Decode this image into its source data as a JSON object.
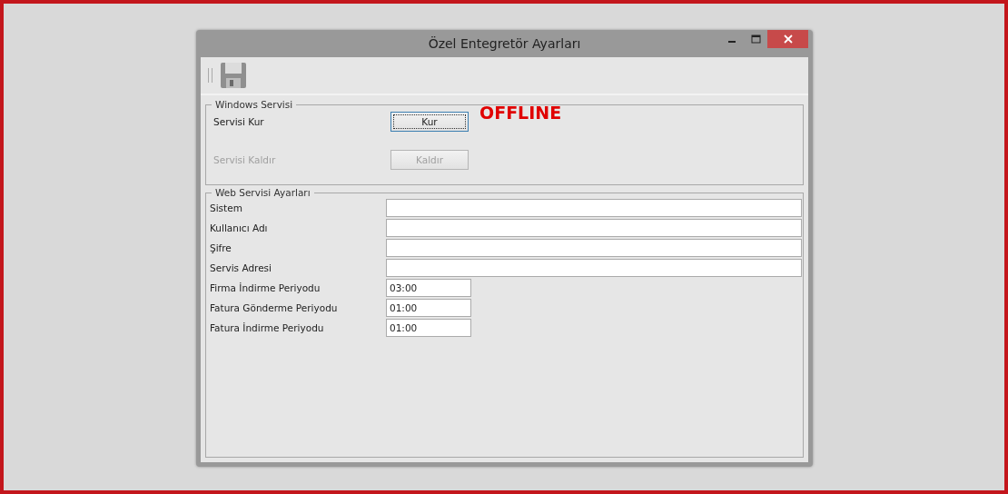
{
  "window": {
    "title": "Özel Entegretör Ayarları"
  },
  "windows_service": {
    "title": "Windows Servisi",
    "status": "OFFLINE",
    "rows": [
      {
        "label": "Servisi Kur",
        "button": "Kur",
        "disabled": false,
        "focused": true
      },
      {
        "label": "Servisi Kaldır",
        "button": "Kaldır",
        "disabled": true,
        "focused": false
      }
    ]
  },
  "web_service": {
    "title": "Web Servisi Ayarları",
    "fields": [
      {
        "label": "Sistem",
        "kind": "wide"
      },
      {
        "label": "Kullanıcı Adı",
        "kind": "wide"
      },
      {
        "label": "Şifre",
        "kind": "wide"
      },
      {
        "label": "Servis Adresi",
        "kind": "wide"
      },
      {
        "label": "Firma İndirme Periyodu",
        "value": "03:00",
        "kind": "short"
      },
      {
        "label": "Fatura Gönderme Periyodu",
        "value": "01:00",
        "kind": "short"
      },
      {
        "label": "Fatura İndirme Periyodu",
        "value": "01:00",
        "kind": "short"
      }
    ]
  }
}
